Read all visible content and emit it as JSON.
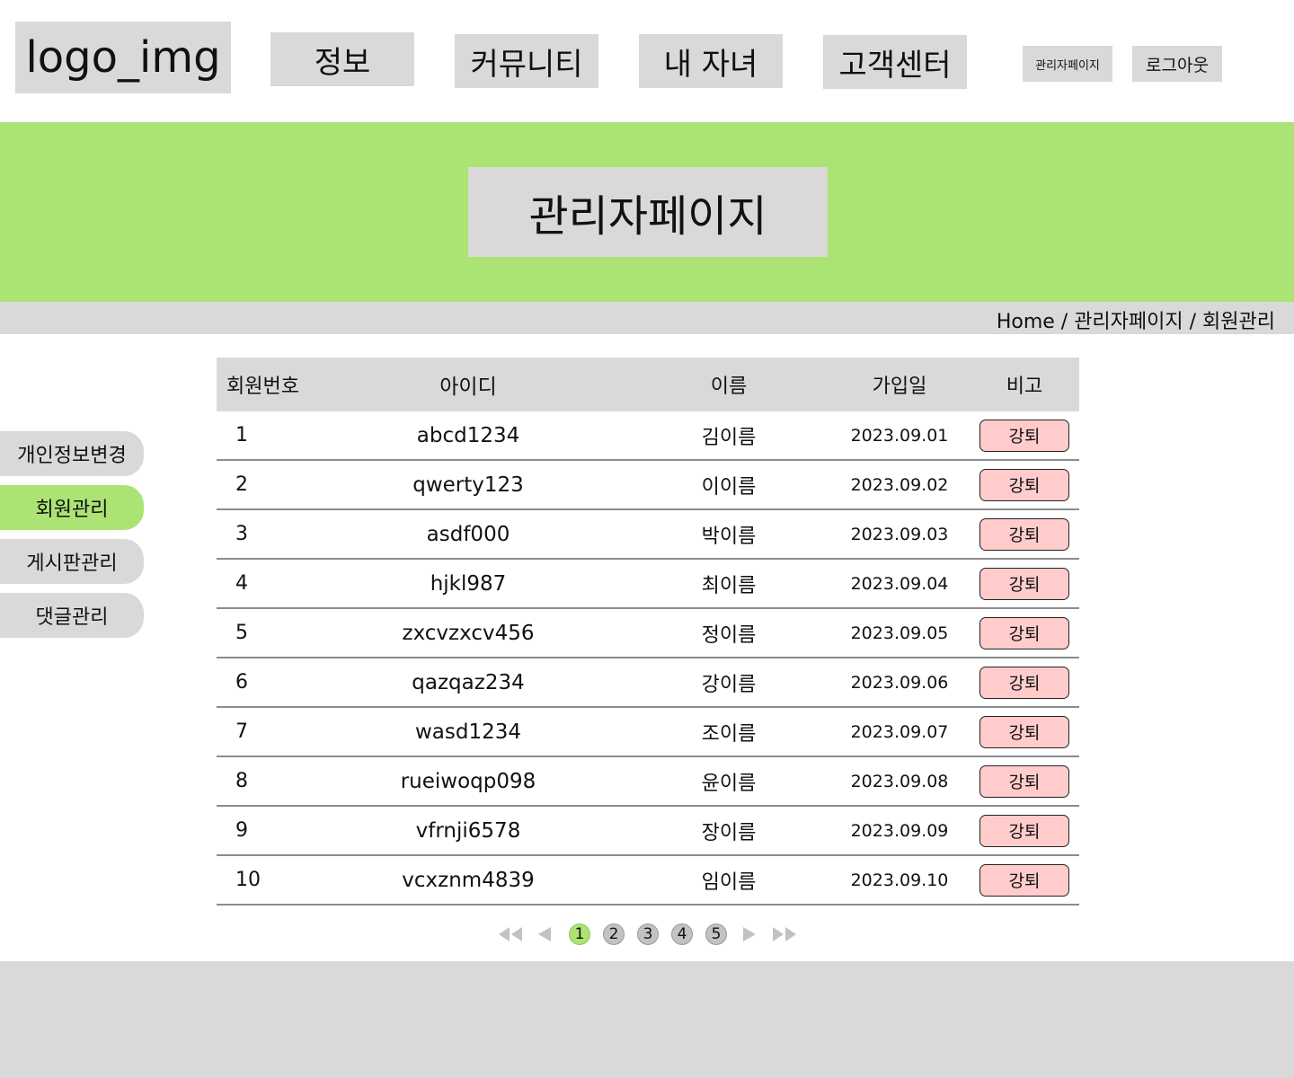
{
  "header": {
    "logo_text": "logo_img",
    "nav": [
      {
        "label": "정보"
      },
      {
        "label": "커뮤니티"
      },
      {
        "label": "내 자녀"
      },
      {
        "label": "고객센터"
      }
    ],
    "admin_page_label": "관리자페이지",
    "logout_label": "로그아웃"
  },
  "banner": {
    "title": "관리자페이지"
  },
  "breadcrumb": "Home / 관리자페이지 / 회원관리",
  "sidebar": {
    "items": [
      {
        "label": "개인정보변경",
        "active": false
      },
      {
        "label": "회원관리",
        "active": true
      },
      {
        "label": "게시판관리",
        "active": false
      },
      {
        "label": "댓글관리",
        "active": false
      }
    ]
  },
  "table": {
    "headers": {
      "no": "회원번호",
      "id": "아이디",
      "name": "이름",
      "date": "가입일",
      "note": "비고"
    },
    "rows": [
      {
        "no": "1",
        "id": "abcd1234",
        "name": "김이름",
        "date": "2023.09.01",
        "action": "강퇴"
      },
      {
        "no": "2",
        "id": "qwerty123",
        "name": "이이름",
        "date": "2023.09.02",
        "action": "강퇴"
      },
      {
        "no": "3",
        "id": "asdf000",
        "name": "박이름",
        "date": "2023.09.03",
        "action": "강퇴"
      },
      {
        "no": "4",
        "id": "hjkl987",
        "name": "최이름",
        "date": "2023.09.04",
        "action": "강퇴"
      },
      {
        "no": "5",
        "id": "zxcvzxcv456",
        "name": "정이름",
        "date": "2023.09.05",
        "action": "강퇴"
      },
      {
        "no": "6",
        "id": "qazqaz234",
        "name": "강이름",
        "date": "2023.09.06",
        "action": "강퇴"
      },
      {
        "no": "7",
        "id": "wasd1234",
        "name": "조이름",
        "date": "2023.09.07",
        "action": "강퇴"
      },
      {
        "no": "8",
        "id": "rueiwoqp098",
        "name": "윤이름",
        "date": "2023.09.08",
        "action": "강퇴"
      },
      {
        "no": "9",
        "id": "vfrnji6578",
        "name": "장이름",
        "date": "2023.09.09",
        "action": "강퇴"
      },
      {
        "no": "10",
        "id": "vcxznm4839",
        "name": "임이름",
        "date": "2023.09.10",
        "action": "강퇴"
      }
    ]
  },
  "pagination": {
    "pages": [
      "1",
      "2",
      "3",
      "4",
      "5"
    ],
    "current": "1",
    "icons": [
      "first-page-icon",
      "prev-page-icon",
      "next-page-icon",
      "last-page-icon"
    ]
  },
  "colors": {
    "accent_green": "#abe374",
    "neutral_gray": "#d9d9d9",
    "kick_button": "#ffcccb"
  }
}
